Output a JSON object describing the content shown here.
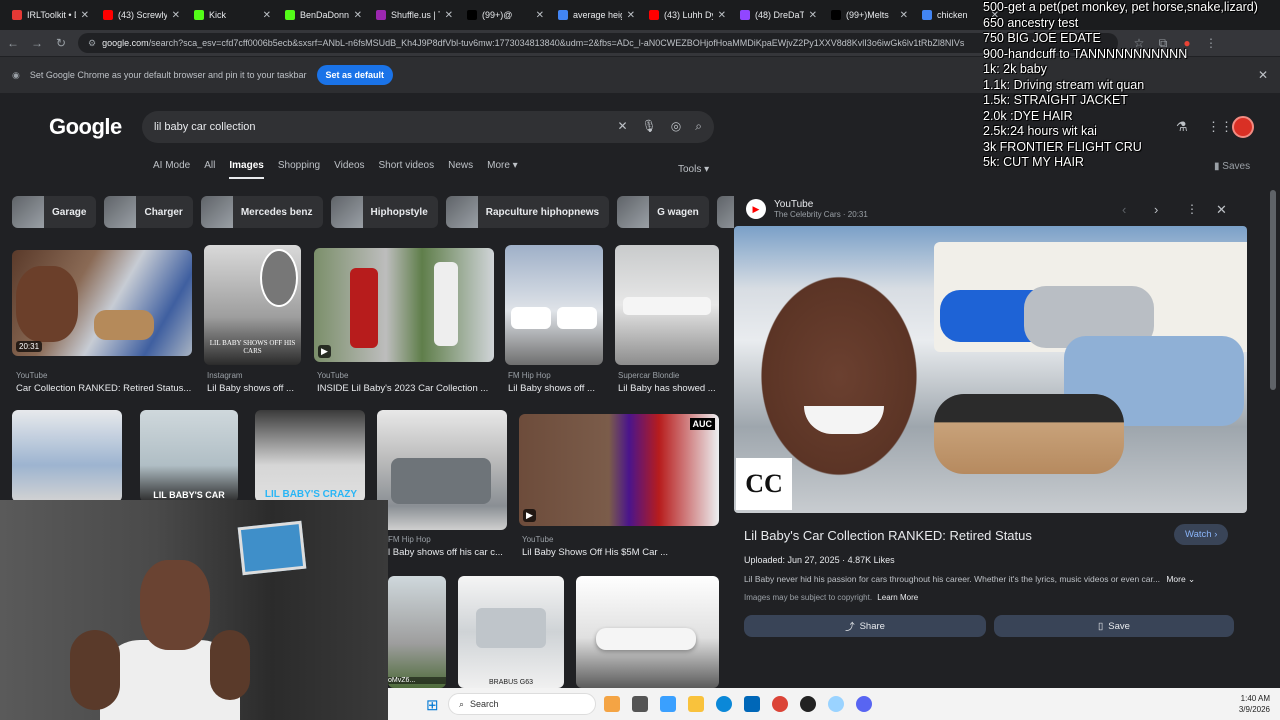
{
  "tabs": [
    {
      "label": "IRLToolkit • D",
      "color": "#e53935"
    },
    {
      "label": "(43) Screwly",
      "color": "#ff0000"
    },
    {
      "label": "Kick",
      "color": "#53fc18"
    },
    {
      "label": "BenDaDonn",
      "color": "#53fc18"
    },
    {
      "label": "Shuffle.us | T",
      "color": "#9c27b0"
    },
    {
      "label": "(99+)@",
      "color": "#000000"
    },
    {
      "label": "average heig",
      "color": "#4285f4"
    },
    {
      "label": "(43) Luhh Dy",
      "color": "#ff0000"
    },
    {
      "label": "(48) DreDaT",
      "color": "#9146ff"
    },
    {
      "label": "(99+)Melts",
      "color": "#000000"
    },
    {
      "label": "chicken",
      "color": "#4285f4"
    }
  ],
  "address": {
    "host": "google.com",
    "path": "/search?sca_esv=cfd7cff0006b5ecb&sxsrf=ANbL-n6fsMSUdB_Kh4J9P8dfVbl-tuv6mw:1773034813840&udm=2&fbs=ADc_l-aN0CWEZBOHjofHoaMMDiKpaEWjvZ2Py1XXV8d8KvlI3o6iwGk6lv1tRbZl8NIVs"
  },
  "infobar": {
    "text": "Set Google Chrome as your default browser and pin it to your taskbar",
    "button": "Set as default"
  },
  "google": {
    "logo": "Google",
    "query": "lil baby car collection",
    "tabs": [
      "AI Mode",
      "All",
      "Images",
      "Shopping",
      "Videos",
      "Short videos",
      "News",
      "More ▾"
    ],
    "tools": "Tools ▾",
    "saves": "Saves"
  },
  "chips": [
    "Garage",
    "Charger",
    "Mercedes benz",
    "Hiphopstyle",
    "Rapculture hiphopnews",
    "G wagen",
    "Brab"
  ],
  "results": [
    {
      "source": "YouTube",
      "title": "Car Collection RANKED: Retired Status...",
      "badge": "20:31"
    },
    {
      "source": "Instagram",
      "title": "Lil Baby shows off ..."
    },
    {
      "source": "YouTube",
      "title": "INSIDE Lil Baby's 2023 Car Collection ..."
    },
    {
      "source": "FM Hip Hop",
      "title": "Lil Baby shows off ..."
    },
    {
      "source": "Supercar Blondie",
      "title": "Lil Baby has showed ..."
    },
    {
      "source": "FM Hip Hop",
      "title": "l Baby shows off his car c..."
    },
    {
      "source": "YouTube",
      "title": "Lil Baby Shows Off His $5M Car ..."
    }
  ],
  "thumb_text": {
    "shows": "LIL BABY SHOWS OFF HIS CARS",
    "car": "LIL BABY'S CAR",
    "crazy": "LIL BABY'S CRAZY",
    "brabus": "BRABUS G63",
    "auc": "AUC",
    "mv": "oMvZ6..."
  },
  "panel": {
    "source": "YouTube",
    "channel": "The Celebrity Cars · 20:31",
    "logo": "CC",
    "title": "Lil Baby's Car Collection RANKED: Retired Status",
    "watch": "Watch ›",
    "meta": "Uploaded: Jun 27, 2025 · 4.87K Likes",
    "desc": "Lil Baby never hid his passion for cars throughout his career. Whether it's the lyrics, music videos or even car...",
    "more": "More ⌄",
    "copyright": "Images may be subject to copyright.",
    "learn": "Learn More",
    "share": "Share",
    "save": "Save"
  },
  "taskbar": {
    "search": "Search",
    "time": "1:40 AM",
    "date": "3/9/2026"
  },
  "overlay": [
    "500-get a pet(pet monkey, pet horse,snake,lizard)",
    "650 ancestry test",
    "750 BIG JOE EDATE",
    "900-handcuff to TANNNNNNNNNNN",
    "1k: 2k baby",
    "1.1k: Driving stream wit quan",
    "1.5k: STRAIGHT JACKET",
    "2.0k :DYE HAIR",
    "2.5k:24 hours wit kai",
    "3k FRONTIER FLIGHT CRU",
    "5k: CUT MY HAIR"
  ]
}
